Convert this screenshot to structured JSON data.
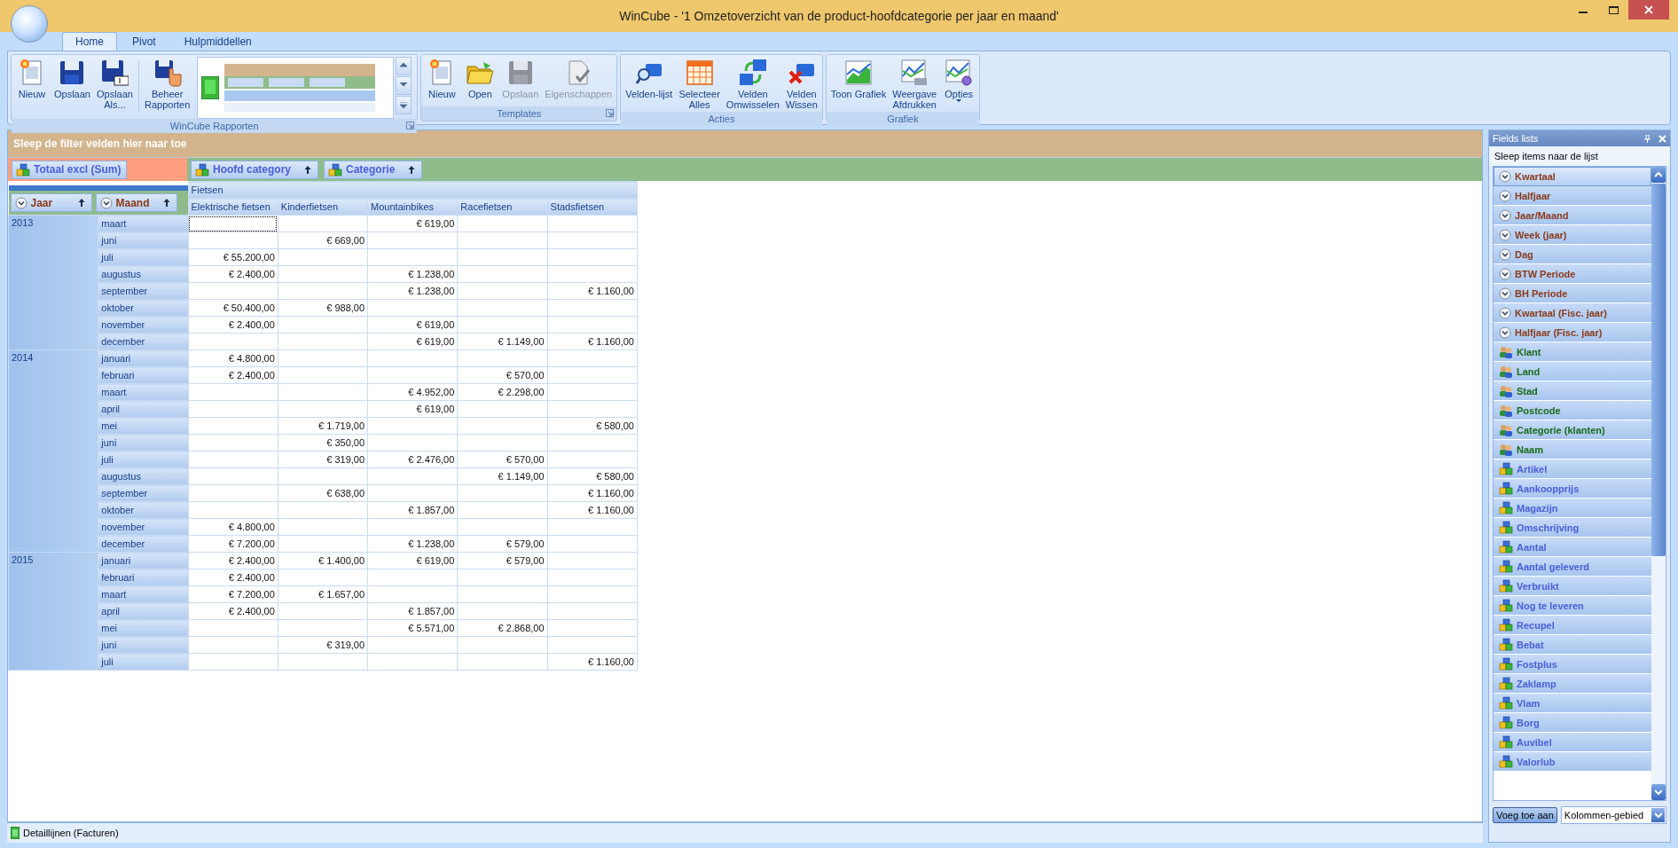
{
  "window": {
    "title": "WinCube - '1 Omzetoverzicht van de product-hoofdcategorie per jaar en maand'"
  },
  "ribbon": {
    "tabs": [
      {
        "label": "Home",
        "selected": true
      },
      {
        "label": "Pivot",
        "selected": false
      },
      {
        "label": "Hulpmiddellen",
        "selected": false
      }
    ],
    "groups": [
      {
        "label": "WinCube Rapporten",
        "launcher": true,
        "items": [
          {
            "kind": "button",
            "label": "Nieuw",
            "disabled": false,
            "dropdown": false
          },
          {
            "kind": "button",
            "label": "Opslaan",
            "disabled": false,
            "dropdown": false
          },
          {
            "kind": "button",
            "label": "Opslaan\nAls...",
            "disabled": false,
            "dropdown": false
          },
          {
            "kind": "button",
            "label": "Beheer\nRapporten",
            "disabled": false,
            "dropdown": false
          },
          {
            "kind": "gallery"
          }
        ]
      },
      {
        "label": "Templates",
        "launcher": true,
        "items": [
          {
            "kind": "button",
            "label": "Nieuw",
            "disabled": false,
            "dropdown": false
          },
          {
            "kind": "button",
            "label": "Open",
            "disabled": false,
            "dropdown": false
          },
          {
            "kind": "button",
            "label": "Opslaan",
            "disabled": true,
            "dropdown": false
          },
          {
            "kind": "button",
            "label": "Eigenschappen",
            "disabled": true,
            "dropdown": false
          }
        ]
      },
      {
        "label": "Acties",
        "launcher": false,
        "items": [
          {
            "kind": "button",
            "label": "Velden-lijst",
            "disabled": false,
            "dropdown": false
          },
          {
            "kind": "button",
            "label": "Selecteer\nAlles",
            "disabled": false,
            "dropdown": false
          },
          {
            "kind": "button",
            "label": "Velden\nOmwisselen",
            "disabled": false,
            "dropdown": false
          },
          {
            "kind": "button",
            "label": "Velden\nWissen",
            "disabled": false,
            "dropdown": false
          }
        ]
      },
      {
        "label": "Grafiek",
        "launcher": false,
        "items": [
          {
            "kind": "button",
            "label": "Toon Grafiek",
            "disabled": false,
            "dropdown": false
          },
          {
            "kind": "button",
            "label": "Weergave\nAfdrukken",
            "disabled": false,
            "dropdown": false
          },
          {
            "kind": "button",
            "label": "Opties",
            "disabled": false,
            "dropdown": true
          }
        ]
      }
    ]
  },
  "pivot": {
    "filter_area": {
      "hint": "Sleep de filter velden hier naar toe"
    },
    "data_fields": [
      {
        "label": "Totaal excl (Sum)",
        "kind": "product"
      }
    ],
    "column_fields": [
      {
        "label": "Hoofd category",
        "kind": "product"
      },
      {
        "label": "Categorie",
        "kind": "product"
      }
    ],
    "row_fields": [
      {
        "label": "Jaar",
        "kind": "date"
      },
      {
        "label": "Maand",
        "kind": "date"
      }
    ],
    "column_group": "Fietsen",
    "columns": [
      "Elektrische fietsen",
      "Kinderfietsen",
      "Mountainbikes",
      "Racefietsen",
      "Stadsfietsen"
    ],
    "rows": [
      {
        "year": "2013",
        "months": [
          {
            "month": "maart",
            "values": {
              "column_3": "€ 619,00"
            }
          },
          {
            "month": "juni",
            "values": {
              "column_2": "€ 669,00"
            }
          },
          {
            "month": "juli",
            "values": {
              "column_1": "€ 55.200,00"
            }
          },
          {
            "month": "augustus",
            "values": {
              "column_1": "€ 2.400,00",
              "column_3": "€ 1.238,00"
            }
          },
          {
            "month": "september",
            "values": {
              "column_3": "€ 1.238,00",
              "column_5": "€ 1.160,00"
            }
          },
          {
            "month": "oktober",
            "values": {
              "column_1": "€ 50.400,00",
              "column_2": "€ 988,00"
            }
          },
          {
            "month": "november",
            "values": {
              "column_1": "€ 2.400,00",
              "column_3": "€ 619,00"
            }
          },
          {
            "month": "december",
            "values": {
              "column_3": "€ 619,00",
              "column_4": "€ 1.149,00",
              "column_5": "€ 1.160,00"
            }
          }
        ]
      },
      {
        "year": "2014",
        "months": [
          {
            "month": "januari",
            "values": {
              "column_1": "€ 4.800,00"
            }
          },
          {
            "month": "februari",
            "values": {
              "column_1": "€ 2.400,00",
              "column_4": "€ 570,00"
            }
          },
          {
            "month": "maart",
            "values": {
              "column_3": "€ 4.952,00",
              "column_4": "€ 2.298,00"
            }
          },
          {
            "month": "april",
            "values": {
              "column_3": "€ 619,00"
            }
          },
          {
            "month": "mei",
            "values": {
              "column_2": "€ 1.719,00",
              "column_5": "€ 580,00"
            }
          },
          {
            "month": "juni",
            "values": {
              "column_2": "€ 350,00"
            }
          },
          {
            "month": "juli",
            "values": {
              "column_2": "€ 319,00",
              "column_3": "€ 2.476,00",
              "column_4": "€ 570,00"
            }
          },
          {
            "month": "augustus",
            "values": {
              "column_4": "€ 1.149,00",
              "column_5": "€ 580,00"
            }
          },
          {
            "month": "september",
            "values": {
              "column_2": "€ 638,00",
              "column_5": "€ 1.160,00"
            }
          },
          {
            "month": "oktober",
            "values": {
              "column_3": "€ 1.857,00",
              "column_5": "€ 1.160,00"
            }
          },
          {
            "month": "november",
            "values": {
              "column_1": "€ 4.800,00"
            }
          },
          {
            "month": "december",
            "values": {
              "column_1": "€ 7.200,00",
              "column_3": "€ 1.238,00",
              "column_4": "€ 579,00"
            }
          }
        ]
      },
      {
        "year": "2015",
        "months": [
          {
            "month": "januari",
            "values": {
              "column_1": "€ 2.400,00",
              "column_2": "€ 1.400,00",
              "column_3": "€ 619,00",
              "column_4": "€ 579,00"
            }
          },
          {
            "month": "februari",
            "values": {
              "column_1": "€ 2.400,00"
            }
          },
          {
            "month": "maart",
            "values": {
              "column_1": "€ 7.200,00",
              "column_2": "€ 1.657,00"
            }
          },
          {
            "month": "april",
            "values": {
              "column_1": "€ 2.400,00",
              "column_3": "€ 1.857,00"
            }
          },
          {
            "month": "mei",
            "values": {
              "column_3": "€ 5.571,00",
              "column_4": "€ 2.868,00"
            }
          },
          {
            "month": "juni",
            "values": {
              "column_2": "€ 319,00"
            }
          },
          {
            "month": "juli",
            "values": {
              "column_5": "€ 1.160,00"
            }
          }
        ]
      }
    ]
  },
  "fields_panel": {
    "title": "Fields lists",
    "hint": "Sleep items naar de lijst",
    "items": [
      {
        "label": "Kwartaal",
        "kind": "date",
        "selected": true
      },
      {
        "label": "Halfjaar",
        "kind": "date",
        "selected": false
      },
      {
        "label": "Jaar/Maand",
        "kind": "date",
        "selected": false
      },
      {
        "label": "Week (jaar)",
        "kind": "date",
        "selected": false
      },
      {
        "label": "Dag",
        "kind": "date",
        "selected": false
      },
      {
        "label": "BTW Periode",
        "kind": "date",
        "selected": false
      },
      {
        "label": "BH Periode",
        "kind": "date",
        "selected": false
      },
      {
        "label": "Kwartaal (Fisc. jaar)",
        "kind": "date",
        "selected": false
      },
      {
        "label": "Halfjaar (Fisc. jaar)",
        "kind": "date",
        "selected": false
      },
      {
        "label": "Klant",
        "kind": "customer",
        "selected": false
      },
      {
        "label": "Land",
        "kind": "customer",
        "selected": false
      },
      {
        "label": "Stad",
        "kind": "customer",
        "selected": false
      },
      {
        "label": "Postcode",
        "kind": "customer",
        "selected": false
      },
      {
        "label": "Categorie (klanten)",
        "kind": "customer",
        "selected": false
      },
      {
        "label": "Naam",
        "kind": "customer",
        "selected": false
      },
      {
        "label": "Artikel",
        "kind": "product",
        "selected": false
      },
      {
        "label": "Aankoopprijs",
        "kind": "product",
        "selected": false
      },
      {
        "label": "Magazijn",
        "kind": "product",
        "selected": false
      },
      {
        "label": "Omschrijving",
        "kind": "product",
        "selected": false
      },
      {
        "label": "Aantal",
        "kind": "product",
        "selected": false
      },
      {
        "label": "Aantal geleverd",
        "kind": "product",
        "selected": false
      },
      {
        "label": "Verbruikt",
        "kind": "product",
        "selected": false
      },
      {
        "label": "Nog te leveren",
        "kind": "product",
        "selected": false
      },
      {
        "label": "Recupel",
        "kind": "product",
        "selected": false
      },
      {
        "label": "Bebat",
        "kind": "product",
        "selected": false
      },
      {
        "label": "Fostplus",
        "kind": "product",
        "selected": false
      },
      {
        "label": "Zaklamp",
        "kind": "product",
        "selected": false
      },
      {
        "label": "Vlam",
        "kind": "product",
        "selected": false
      },
      {
        "label": "Borg",
        "kind": "product",
        "selected": false
      },
      {
        "label": "Auvibel",
        "kind": "product",
        "selected": false
      },
      {
        "label": "Valorlub",
        "kind": "product",
        "selected": false
      }
    ],
    "add_button": "Voeg toe aan",
    "target": {
      "value": "Kolommen-gebied"
    }
  },
  "status_bar": {
    "text": "Detaillijnen (Facturen)"
  }
}
